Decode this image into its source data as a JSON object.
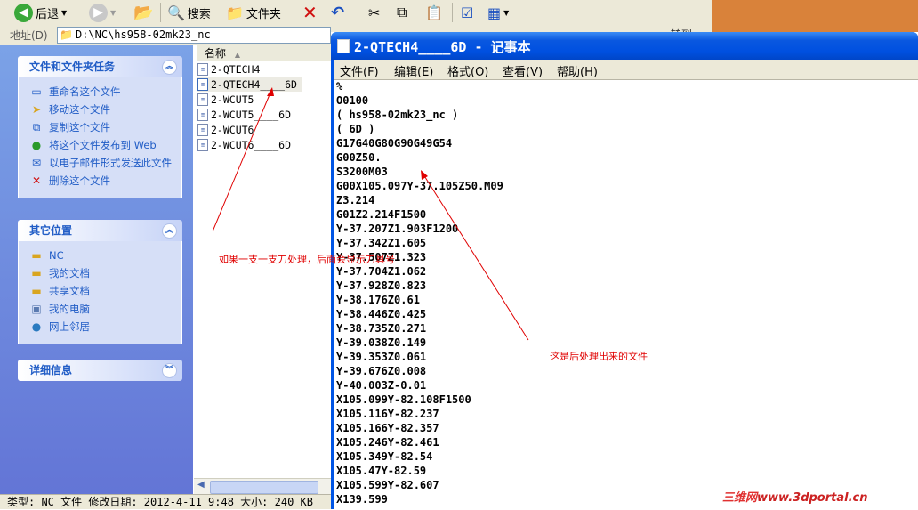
{
  "explorer": {
    "toolbar": {
      "back": "后退",
      "search": "搜索",
      "folders": "文件夹"
    },
    "address": {
      "label": "地址(D)",
      "path": "D:\\NC\\hs958-02mk23_nc",
      "go": "转到"
    },
    "tasks_panel": {
      "title": "文件和文件夹任务",
      "items": [
        "重命名这个文件",
        "移动这个文件",
        "复制这个文件",
        "将这个文件发布到 Web",
        "以电子邮件形式发送此文件",
        "删除这个文件"
      ]
    },
    "places_panel": {
      "title": "其它位置",
      "items": [
        "NC",
        "我的文档",
        "共享文档",
        "我的电脑",
        "网上邻居"
      ]
    },
    "details_panel": {
      "title": "详细信息"
    },
    "file_list": {
      "column_name": "名称",
      "files": [
        "2-QTECH4",
        "2-QTECH4____6D",
        "2-WCUT5",
        "2-WCUT5____6D",
        "2-WCUT6",
        "2-WCUT6____6D"
      ]
    },
    "status": "类型: NC 文件 修改日期: 2012-4-11 9:48 大小: 240 KB"
  },
  "notepad": {
    "title": "2-QTECH4____6D - 记事本",
    "menu": [
      "文件(F)",
      "编辑(E)",
      "格式(O)",
      "查看(V)",
      "帮助(H)"
    ],
    "lines": [
      "%",
      "O0100",
      "( hs958-02mk23_nc )",
      "( 6D )",
      "G17G40G80G90G49G54",
      "G00Z50.",
      "S3200M03",
      "G00X105.097Y-37.105Z50.M09",
      "Z3.214",
      "G01Z2.214F1500",
      "Y-37.207Z1.903F1200",
      "Y-37.342Z1.605",
      "Y-37.507Z1.323",
      "Y-37.704Z1.062",
      "Y-37.928Z0.823",
      "Y-38.176Z0.61",
      "Y-38.446Z0.425",
      "Y-38.735Z0.271",
      "Y-39.038Z0.149",
      "Y-39.353Z0.061",
      "Y-39.676Z0.008",
      "Y-40.003Z-0.01",
      "X105.099Y-82.108F1500",
      "X105.116Y-82.237",
      "X105.166Y-82.357",
      "X105.246Y-82.461",
      "X105.349Y-82.54",
      "X105.47Y-82.59",
      "X105.599Y-82.607",
      "X139.599"
    ]
  },
  "annotations": {
    "left": "如果一支一支刀处理，后面会显示刀具号",
    "right": "这是后处理出来的文件"
  },
  "watermark": {
    "cn": "三维网",
    "url": "www.3dportal.cn"
  },
  "colors": {
    "annotation": "#e00000",
    "xp_title_blue": "#0050e0",
    "taskpane_blue": "#6f8ee0"
  }
}
